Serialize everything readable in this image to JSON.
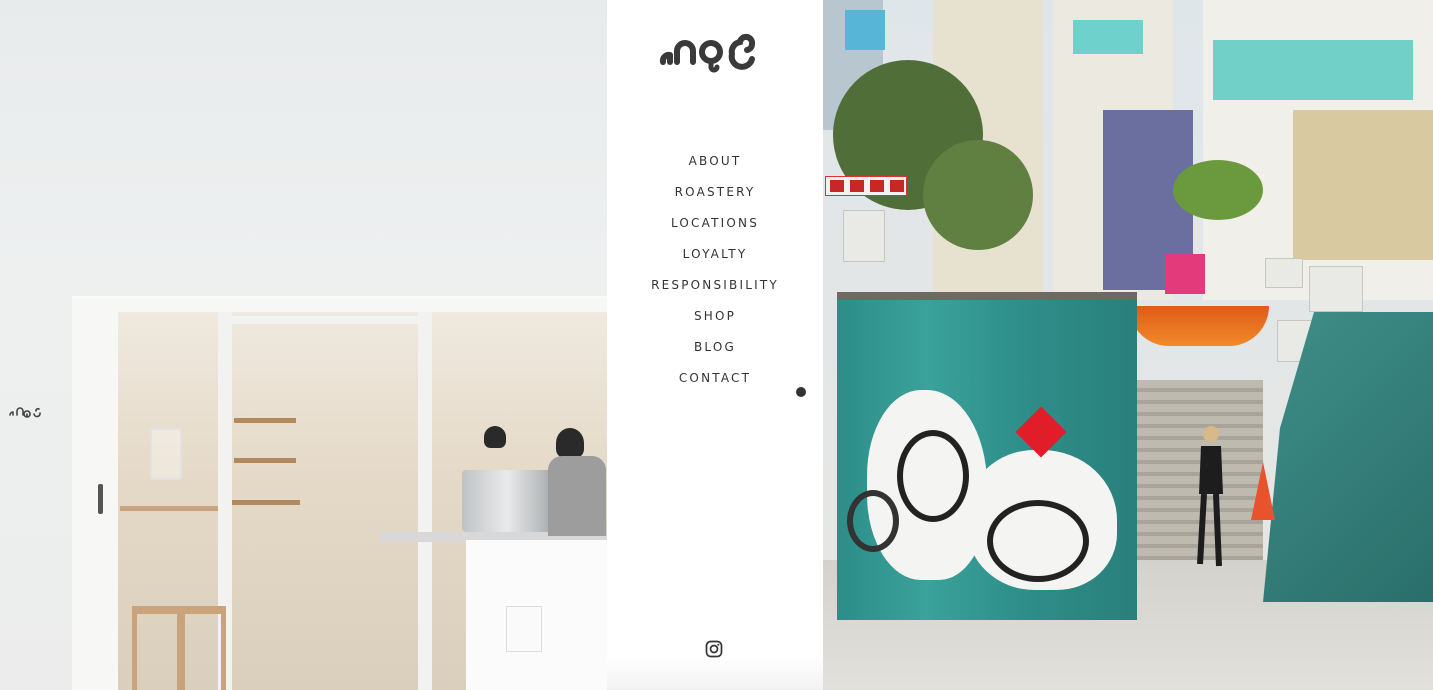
{
  "brand": {
    "logo_text": "noc"
  },
  "nav": {
    "items": [
      {
        "label": "ABOUT"
      },
      {
        "label": "ROASTERY"
      },
      {
        "label": "LOCATIONS"
      },
      {
        "label": "LOYALTY"
      },
      {
        "label": "RESPONSIBILITY"
      },
      {
        "label": "SHOP"
      },
      {
        "label": "BLOG"
      },
      {
        "label": "CONTACT"
      }
    ]
  },
  "social": {
    "icon": "instagram-icon"
  },
  "images": {
    "left": {
      "subject": "noc coffee shop storefront"
    },
    "right": {
      "subject": "graffiti booth street scene"
    }
  },
  "colors": {
    "text": "#333333",
    "background": "#ffffff"
  }
}
